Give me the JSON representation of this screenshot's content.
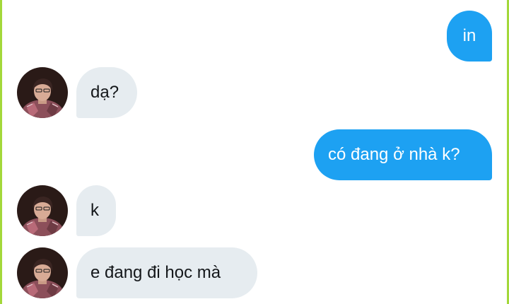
{
  "conversation": {
    "messages": [
      {
        "sender": "me",
        "text": "in"
      },
      {
        "sender": "contact",
        "text": "dạ?"
      },
      {
        "sender": "me",
        "text": "có đang ở nhà k?"
      },
      {
        "sender": "contact",
        "text": "k"
      },
      {
        "sender": "contact",
        "text": "e đang đi học mà"
      }
    ]
  },
  "colors": {
    "outgoing_bubble": "#1da1f2",
    "incoming_bubble": "#e6ecf0",
    "frame_border": "#a3d83a"
  },
  "icons": {
    "avatar": "contact-avatar-photo"
  }
}
